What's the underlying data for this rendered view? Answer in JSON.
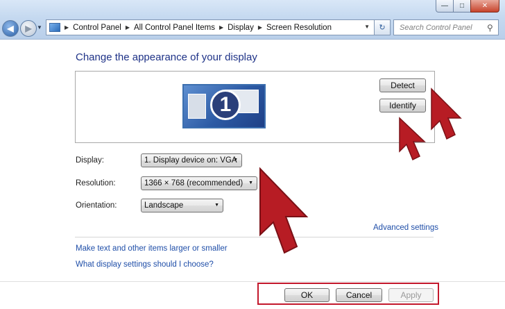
{
  "window": {
    "minimize_icon": "minimize-icon",
    "maximize_icon": "maximize-icon",
    "close_icon": "close-icon",
    "minimize_glyph": "—",
    "maximize_glyph": "□",
    "close_glyph": "✕"
  },
  "nav": {
    "back_glyph": "◀",
    "forward_glyph": "▶",
    "recent_glyph": "▼"
  },
  "breadcrumb": {
    "sep_glyph": "▶",
    "items": [
      "Control Panel",
      "All Control Panel Items",
      "Display",
      "Screen Resolution"
    ],
    "dropdown_glyph": "▼"
  },
  "refresh": {
    "glyph": "↻"
  },
  "search": {
    "placeholder": "Search Control Panel",
    "icon_glyph": "⚲"
  },
  "main": {
    "title": "Change the appearance of your display",
    "monitor_number": "1",
    "detect_label": "Detect",
    "identify_label": "Identify"
  },
  "settings": {
    "display_label": "Display:",
    "display_value": "1. Display device on: VGA",
    "resolution_label": "Resolution:",
    "resolution_value": "1366 × 768 (recommended)",
    "orientation_label": "Orientation:",
    "orientation_value": "Landscape",
    "combo_arrow": "▼"
  },
  "links": {
    "advanced": "Advanced settings",
    "text_size": "Make text and other items larger or smaller",
    "help": "What display settings should I choose?"
  },
  "buttons": {
    "ok": "OK",
    "cancel": "Cancel",
    "apply": "Apply"
  },
  "colors": {
    "link": "#1f4ea8",
    "title": "#1e3287",
    "highlight": "#c3182c",
    "cursor_fill": "#b71c24"
  }
}
